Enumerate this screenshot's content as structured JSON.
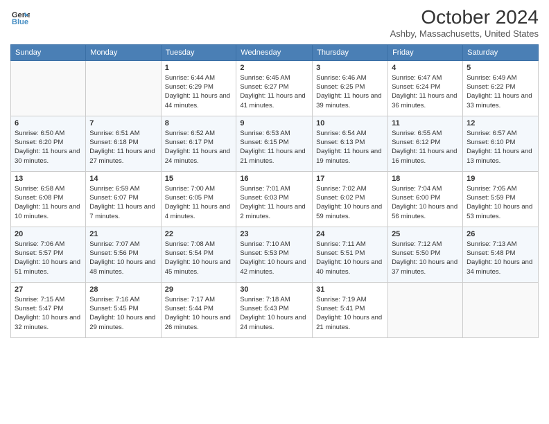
{
  "logo": {
    "line1": "General",
    "line2": "Blue"
  },
  "title": "October 2024",
  "location": "Ashby, Massachusetts, United States",
  "weekdays": [
    "Sunday",
    "Monday",
    "Tuesday",
    "Wednesday",
    "Thursday",
    "Friday",
    "Saturday"
  ],
  "weeks": [
    [
      {
        "day": null
      },
      {
        "day": null
      },
      {
        "day": "1",
        "sunrise": "6:44 AM",
        "sunset": "6:29 PM",
        "daylight": "11 hours and 44 minutes."
      },
      {
        "day": "2",
        "sunrise": "6:45 AM",
        "sunset": "6:27 PM",
        "daylight": "11 hours and 41 minutes."
      },
      {
        "day": "3",
        "sunrise": "6:46 AM",
        "sunset": "6:25 PM",
        "daylight": "11 hours and 39 minutes."
      },
      {
        "day": "4",
        "sunrise": "6:47 AM",
        "sunset": "6:24 PM",
        "daylight": "11 hours and 36 minutes."
      },
      {
        "day": "5",
        "sunrise": "6:49 AM",
        "sunset": "6:22 PM",
        "daylight": "11 hours and 33 minutes."
      }
    ],
    [
      {
        "day": "6",
        "sunrise": "6:50 AM",
        "sunset": "6:20 PM",
        "daylight": "11 hours and 30 minutes."
      },
      {
        "day": "7",
        "sunrise": "6:51 AM",
        "sunset": "6:18 PM",
        "daylight": "11 hours and 27 minutes."
      },
      {
        "day": "8",
        "sunrise": "6:52 AM",
        "sunset": "6:17 PM",
        "daylight": "11 hours and 24 minutes."
      },
      {
        "day": "9",
        "sunrise": "6:53 AM",
        "sunset": "6:15 PM",
        "daylight": "11 hours and 21 minutes."
      },
      {
        "day": "10",
        "sunrise": "6:54 AM",
        "sunset": "6:13 PM",
        "daylight": "11 hours and 19 minutes."
      },
      {
        "day": "11",
        "sunrise": "6:55 AM",
        "sunset": "6:12 PM",
        "daylight": "11 hours and 16 minutes."
      },
      {
        "day": "12",
        "sunrise": "6:57 AM",
        "sunset": "6:10 PM",
        "daylight": "11 hours and 13 minutes."
      }
    ],
    [
      {
        "day": "13",
        "sunrise": "6:58 AM",
        "sunset": "6:08 PM",
        "daylight": "11 hours and 10 minutes."
      },
      {
        "day": "14",
        "sunrise": "6:59 AM",
        "sunset": "6:07 PM",
        "daylight": "11 hours and 7 minutes."
      },
      {
        "day": "15",
        "sunrise": "7:00 AM",
        "sunset": "6:05 PM",
        "daylight": "11 hours and 4 minutes."
      },
      {
        "day": "16",
        "sunrise": "7:01 AM",
        "sunset": "6:03 PM",
        "daylight": "11 hours and 2 minutes."
      },
      {
        "day": "17",
        "sunrise": "7:02 AM",
        "sunset": "6:02 PM",
        "daylight": "10 hours and 59 minutes."
      },
      {
        "day": "18",
        "sunrise": "7:04 AM",
        "sunset": "6:00 PM",
        "daylight": "10 hours and 56 minutes."
      },
      {
        "day": "19",
        "sunrise": "7:05 AM",
        "sunset": "5:59 PM",
        "daylight": "10 hours and 53 minutes."
      }
    ],
    [
      {
        "day": "20",
        "sunrise": "7:06 AM",
        "sunset": "5:57 PM",
        "daylight": "10 hours and 51 minutes."
      },
      {
        "day": "21",
        "sunrise": "7:07 AM",
        "sunset": "5:56 PM",
        "daylight": "10 hours and 48 minutes."
      },
      {
        "day": "22",
        "sunrise": "7:08 AM",
        "sunset": "5:54 PM",
        "daylight": "10 hours and 45 minutes."
      },
      {
        "day": "23",
        "sunrise": "7:10 AM",
        "sunset": "5:53 PM",
        "daylight": "10 hours and 42 minutes."
      },
      {
        "day": "24",
        "sunrise": "7:11 AM",
        "sunset": "5:51 PM",
        "daylight": "10 hours and 40 minutes."
      },
      {
        "day": "25",
        "sunrise": "7:12 AM",
        "sunset": "5:50 PM",
        "daylight": "10 hours and 37 minutes."
      },
      {
        "day": "26",
        "sunrise": "7:13 AM",
        "sunset": "5:48 PM",
        "daylight": "10 hours and 34 minutes."
      }
    ],
    [
      {
        "day": "27",
        "sunrise": "7:15 AM",
        "sunset": "5:47 PM",
        "daylight": "10 hours and 32 minutes."
      },
      {
        "day": "28",
        "sunrise": "7:16 AM",
        "sunset": "5:45 PM",
        "daylight": "10 hours and 29 minutes."
      },
      {
        "day": "29",
        "sunrise": "7:17 AM",
        "sunset": "5:44 PM",
        "daylight": "10 hours and 26 minutes."
      },
      {
        "day": "30",
        "sunrise": "7:18 AM",
        "sunset": "5:43 PM",
        "daylight": "10 hours and 24 minutes."
      },
      {
        "day": "31",
        "sunrise": "7:19 AM",
        "sunset": "5:41 PM",
        "daylight": "10 hours and 21 minutes."
      },
      {
        "day": null
      },
      {
        "day": null
      }
    ]
  ]
}
